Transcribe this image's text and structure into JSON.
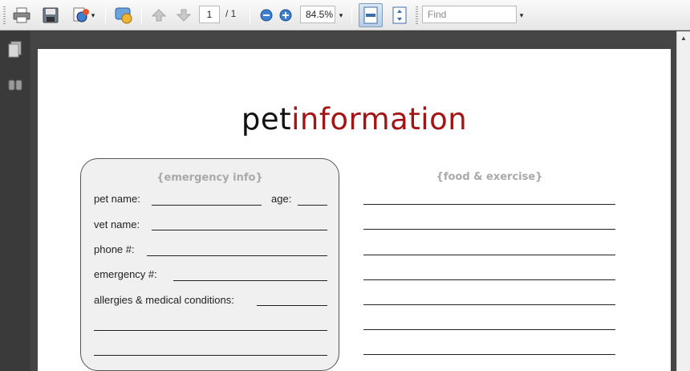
{
  "toolbar": {
    "page_current": "1",
    "page_total": "/ 1",
    "zoom": "84.5%",
    "find_placeholder": "Find",
    "icons": [
      "print-icon",
      "save-icon",
      "sign-icon",
      "comment-icon",
      "prev-page-icon",
      "next-page-icon",
      "zoom-out-icon",
      "zoom-in-icon",
      "fit-page-icon",
      "fit-width-icon"
    ]
  },
  "leftnav": {
    "icons": [
      "pages-icon",
      "attachments-icon"
    ]
  },
  "document": {
    "title_part1": "pet",
    "title_part2": "information",
    "title_colors": {
      "part1": "#111111",
      "part2": "#a31515"
    },
    "card": {
      "heading": "{emergency info}",
      "fields": {
        "pet_name": "pet name:",
        "age": "age:",
        "vet_name": "vet name:",
        "phone": "phone #:",
        "emergency": "emergency #:",
        "allergies": "allergies & medical conditions:"
      }
    },
    "right_column": {
      "heading": "{food & exercise}"
    }
  }
}
